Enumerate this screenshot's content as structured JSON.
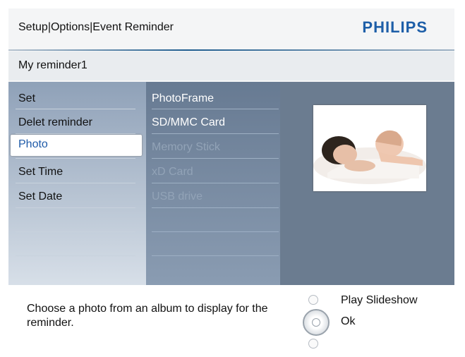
{
  "header": {
    "breadcrumb": "Setup|Options|Event Reminder",
    "brand": "PHILIPS",
    "subtitle": "My reminder1"
  },
  "menu": {
    "items": [
      {
        "label": "Set"
      },
      {
        "label": "Delet reminder"
      },
      {
        "label": "Photo",
        "selected": true
      },
      {
        "label": "Set Time"
      },
      {
        "label": "Set Date"
      }
    ]
  },
  "sources": {
    "items": [
      {
        "label": "PhotoFrame",
        "state": "active"
      },
      {
        "label": "SD/MMC Card",
        "state": "active"
      },
      {
        "label": "Memory Stick",
        "state": "dim"
      },
      {
        "label": "xD Card",
        "state": "dim"
      },
      {
        "label": "USB drive",
        "state": "dim"
      }
    ]
  },
  "footer": {
    "help": "Choose a photo from an album to display for the reminder.",
    "options": [
      {
        "label": "Play Slideshow"
      },
      {
        "label": "Ok"
      }
    ]
  },
  "colors": {
    "brand": "#1d5ea8",
    "selected_text": "#1e5aa8"
  }
}
